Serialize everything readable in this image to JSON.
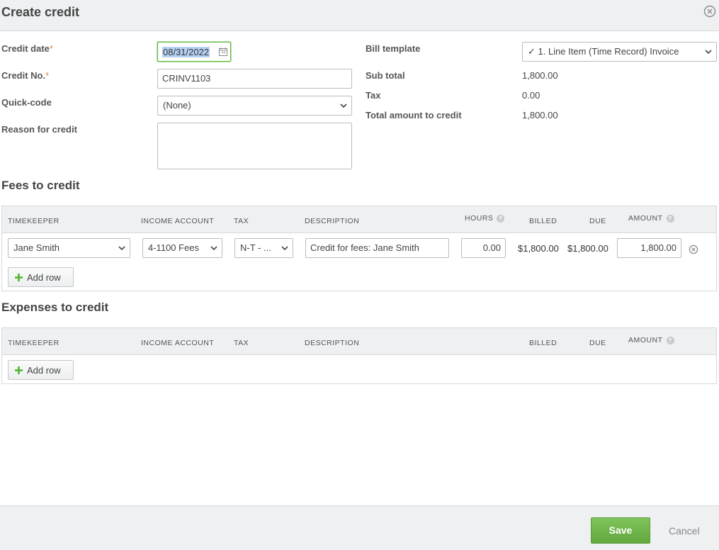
{
  "dialog": {
    "title": "Create credit"
  },
  "form": {
    "credit_date_label": "Credit date",
    "credit_date_value": "08/31/2022",
    "credit_no_label": "Credit No.",
    "credit_no_value": "CRINV1103",
    "quick_code_label": "Quick-code",
    "quick_code_value": "(None)",
    "reason_label": "Reason for credit",
    "reason_value": "",
    "required_mark": "*"
  },
  "summary": {
    "bill_template_label": "Bill template",
    "bill_template_value": "✓ 1. Line Item (Time Record) Invoice",
    "sub_total_label": "Sub total",
    "sub_total_value": "1,800.00",
    "tax_label": "Tax",
    "tax_value": "0.00",
    "total_label": "Total amount to credit",
    "total_value": "1,800.00"
  },
  "fees": {
    "title": "Fees to credit",
    "columns": {
      "timekeeper": "TIMEKEEPER",
      "income_account": "INCOME ACCOUNT",
      "tax": "TAX",
      "description": "DESCRIPTION",
      "hours": "HOURS",
      "billed": "BILLED",
      "due": "DUE",
      "amount": "AMOUNT"
    },
    "rows": [
      {
        "timekeeper": "Jane  Smith",
        "income_account": "4-1100 Fees",
        "tax": "N-T - ...",
        "description": "Credit for fees:  Jane Smith",
        "hours": "0.00",
        "billed": "$1,800.00",
        "due": "$1,800.00",
        "amount": "1,800.00"
      }
    ],
    "add_row_label": "Add row"
  },
  "expenses": {
    "title": "Expenses to credit",
    "columns": {
      "timekeeper": "TIMEKEEPER",
      "income_account": "INCOME ACCOUNT",
      "tax": "TAX",
      "description": "DESCRIPTION",
      "billed": "BILLED",
      "due": "DUE",
      "amount": "AMOUNT"
    },
    "add_row_label": "Add row"
  },
  "help_glyph": "?",
  "footer": {
    "save_label": "Save",
    "cancel_label": "Cancel"
  },
  "colors": {
    "accent_green": "#6ab446",
    "required_orange": "#e8893a",
    "header_bg": "#eef0f2"
  }
}
